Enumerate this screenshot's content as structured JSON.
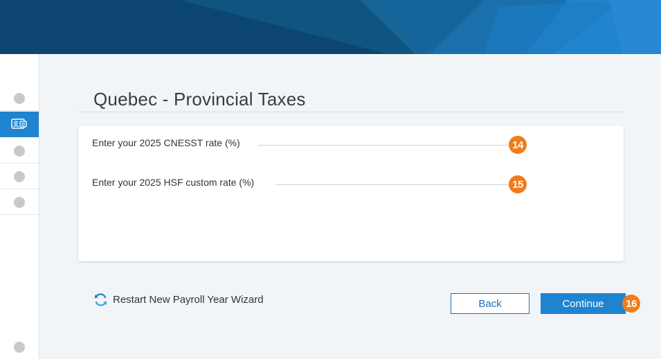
{
  "header": {
    "brand_colors": {
      "base": "#0d4a74",
      "accent": "#1f84d0"
    }
  },
  "sidebar": {
    "items": [
      {
        "icon": "step-dot"
      },
      {
        "icon": "id-card-icon",
        "active": true
      },
      {
        "icon": "step-dot"
      },
      {
        "icon": "step-dot"
      },
      {
        "icon": "step-dot"
      }
    ],
    "bottom_icon": "step-dot"
  },
  "page": {
    "title": "Quebec - Provincial Taxes"
  },
  "form": {
    "fields": [
      {
        "label": "Enter your 2025 CNESST rate (%)",
        "value": "",
        "badge": "14"
      },
      {
        "label": "Enter your 2025 HSF custom rate (%)",
        "value": "",
        "badge": "15"
      }
    ]
  },
  "footer": {
    "restart_label": "Restart New Payroll Year Wizard",
    "back_label": "Back",
    "continue_label": "Continue",
    "continue_badge": "16"
  },
  "colors": {
    "badge": "#f07c1a",
    "primary": "#1f84d0"
  }
}
